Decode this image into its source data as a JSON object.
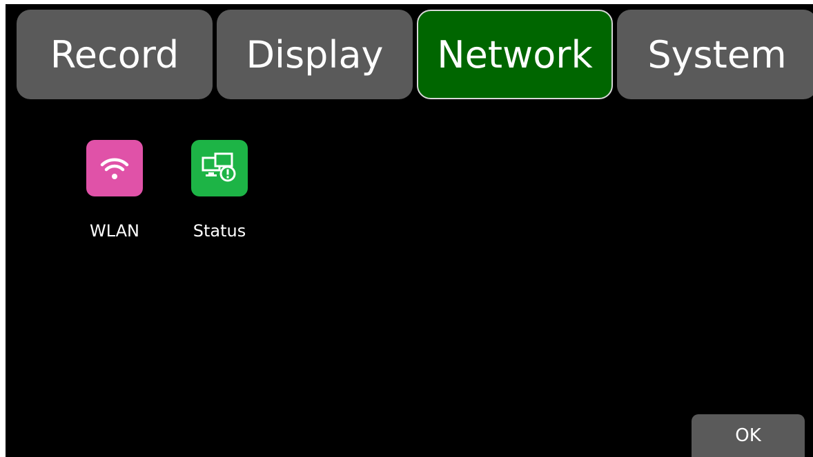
{
  "tabs": [
    {
      "label": "Record",
      "active": false
    },
    {
      "label": "Display",
      "active": false
    },
    {
      "label": "Network",
      "active": true
    },
    {
      "label": "System",
      "active": false
    }
  ],
  "apps": [
    {
      "label": "WLAN",
      "icon": "wifi-icon",
      "color": "#e052a8"
    },
    {
      "label": "Status",
      "icon": "network-status-icon",
      "color": "#1db446"
    }
  ],
  "footer": {
    "ok_label": "OK"
  },
  "colors": {
    "background": "#000000",
    "tab_inactive": "#5a5a5a",
    "tab_active": "#006600"
  }
}
